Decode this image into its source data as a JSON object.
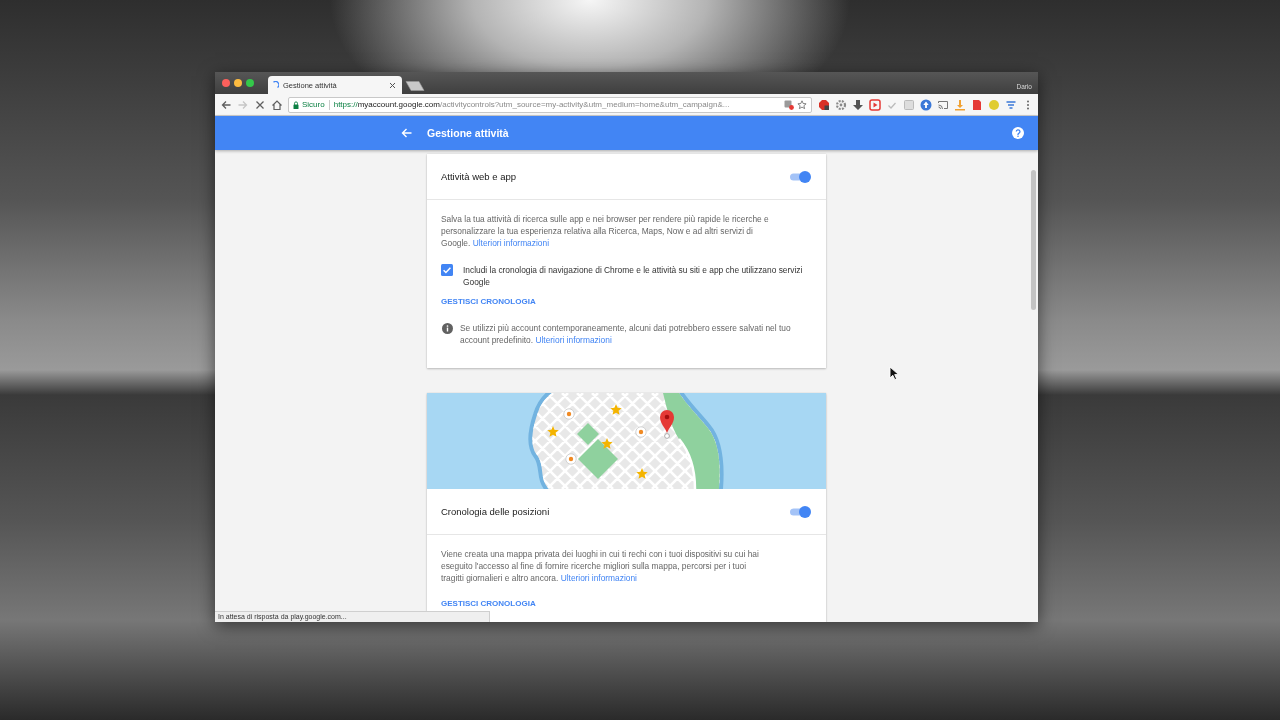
{
  "browser": {
    "tabs": [
      {
        "title": "Gestione attività",
        "loading": true,
        "selected": true
      }
    ],
    "profile_name": "Dario",
    "toolbar_buttons": [
      {
        "kind": "back",
        "disabled": false
      },
      {
        "kind": "forward",
        "disabled": true
      },
      {
        "kind": "stop",
        "disabled": false
      },
      {
        "kind": "home",
        "disabled": false
      }
    ],
    "address_bar": {
      "security_label": "Sicuro",
      "url_scheme": "https://",
      "url_host": "myaccount.google.com",
      "url_path": "/activitycontrols?utm_source=my-activity&utm_medium=home&utm_campaign&..."
    },
    "status_text": "In attesa di risposta da play.google.com..."
  },
  "app_bar": {
    "title": "Gestione attività"
  },
  "cards": [
    {
      "kind": "plain",
      "title": "Attività web e app",
      "on": true,
      "description": "Salva la tua attività di ricerca sulle app e nei browser per rendere più rapide le ricerche e personalizzare la tua esperienza relativa alla Ricerca, Maps, Now e ad altri servizi di Google.",
      "description_link": "Ulteriori informazioni",
      "checkbox": {
        "label": "Includi la cronologia di navigazione di Chrome e le attività su siti e app che utilizzano servizi Google",
        "checked": true
      },
      "action": "GESTISCI CRONOLOGIA",
      "note": {
        "text": "Se utilizzi più account contemporaneamente, alcuni dati potrebbero essere salvati nel tuo account predefinito.",
        "link": "Ulteriori informazioni"
      }
    },
    {
      "kind": "map",
      "title": "Cronologia delle posizioni",
      "on": true,
      "description": "Viene creata una mappa privata dei luoghi in cui ti rechi con i tuoi dispositivi su cui hai eseguito l'accesso al fine di fornire ricerche migliori sulla mappa, percorsi per i tuoi tragitti giornalieri e altro ancora.",
      "description_link": "Ulteriori informazioni",
      "action": "GESTISCI CRONOLOGIA"
    }
  ]
}
